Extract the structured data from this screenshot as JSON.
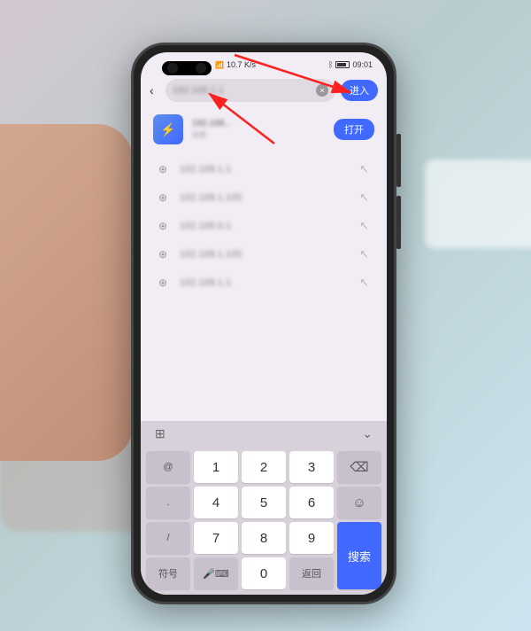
{
  "statusbar": {
    "speed": "10.7 K/s",
    "carrier": "4G",
    "time": "09:01"
  },
  "search": {
    "query": "192.168.1.1",
    "enter_label": "进入"
  },
  "result": {
    "title": "192.168...",
    "subtitle": "应用",
    "open_label": "打开"
  },
  "suggestions": [
    {
      "text": "192.168.1.1"
    },
    {
      "text": "192.168.1.100"
    },
    {
      "text": "192.168.0.1"
    },
    {
      "text": "192.168.1.100"
    },
    {
      "text": "192.168.1.1"
    }
  ],
  "keyboard": {
    "rows": [
      [
        "@",
        "1",
        "2",
        "3",
        "⌫"
      ],
      [
        ".",
        "4",
        "5",
        "6",
        "☺"
      ],
      [
        "/",
        "7",
        "8",
        "9",
        ""
      ],
      [
        "符号",
        "切换",
        "0",
        "返回",
        "搜索"
      ]
    ],
    "symbol_label": "符号",
    "return_label": "返回",
    "search_label": "搜索",
    "space_label": "0"
  }
}
